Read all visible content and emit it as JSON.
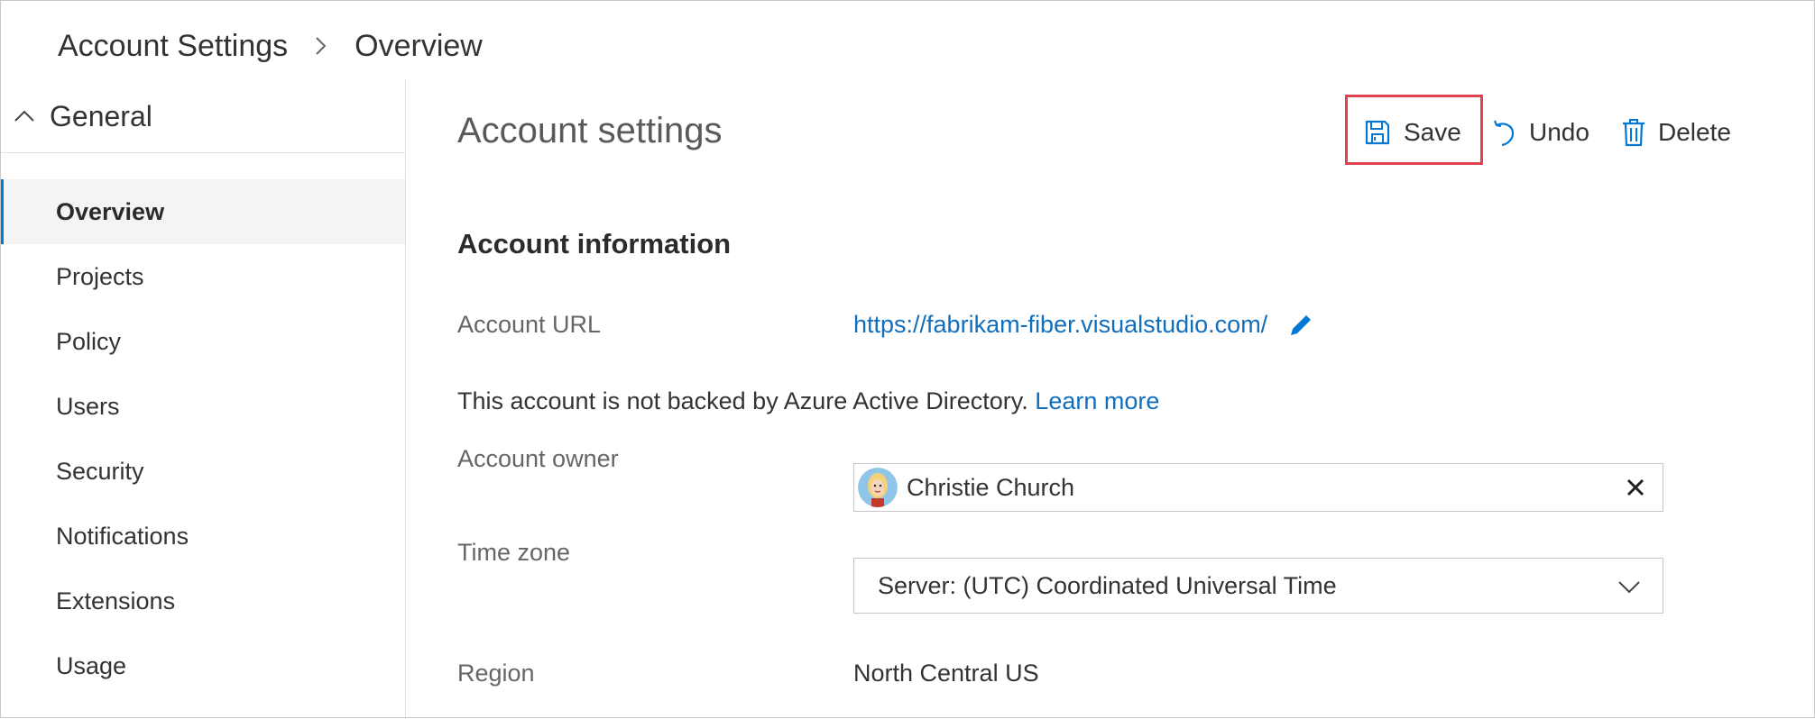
{
  "breadcrumb": {
    "root": "Account Settings",
    "current": "Overview"
  },
  "sidebar": {
    "group_label": "General",
    "items": [
      {
        "label": "Overview",
        "selected": true
      },
      {
        "label": "Projects"
      },
      {
        "label": "Policy"
      },
      {
        "label": "Users"
      },
      {
        "label": "Security"
      },
      {
        "label": "Notifications"
      },
      {
        "label": "Extensions"
      },
      {
        "label": "Usage"
      }
    ]
  },
  "main": {
    "title": "Account settings",
    "toolbar": {
      "save_label": "Save",
      "undo_label": "Undo",
      "delete_label": "Delete"
    },
    "section_title": "Account information",
    "account_url": {
      "label": "Account URL",
      "value": "https://fabrikam-fiber.visualstudio.com/"
    },
    "aad_notice": {
      "text": "This account is not backed by Azure Active Directory. ",
      "link": "Learn more"
    },
    "account_owner": {
      "label": "Account owner",
      "value": "Christie Church"
    },
    "time_zone": {
      "label": "Time zone",
      "value": "Server: (UTC) Coordinated Universal Time"
    },
    "region": {
      "label": "Region",
      "value": "North Central US"
    }
  },
  "colors": {
    "accent": "#0078d4",
    "link": "#106ebe",
    "highlight_border": "#e0414c",
    "selected_bg": "#f4f4f4"
  },
  "icons": {
    "breadcrumb_separator": "chevron-right-icon",
    "group_toggle": "chevron-up-icon",
    "save": "save-icon",
    "undo": "undo-icon",
    "delete": "trash-icon",
    "edit": "pencil-icon",
    "clear": "close-icon",
    "dropdown": "chevron-down-icon"
  }
}
